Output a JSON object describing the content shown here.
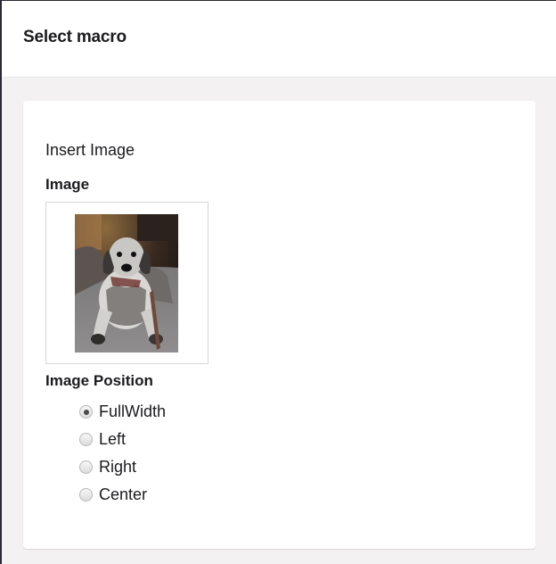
{
  "header": {
    "title": "Select macro"
  },
  "macro": {
    "title": "Insert Image",
    "image_label": "Image",
    "image_alt": "Dog photo",
    "position_label": "Image Position",
    "position_options": [
      {
        "label": "FullWidth",
        "selected": true
      },
      {
        "label": "Left",
        "selected": false
      },
      {
        "label": "Right",
        "selected": false
      },
      {
        "label": "Center",
        "selected": false
      }
    ]
  },
  "colors": {
    "background": "#f3f1f2",
    "panel": "#ffffff",
    "text": "#1b1b1f"
  }
}
